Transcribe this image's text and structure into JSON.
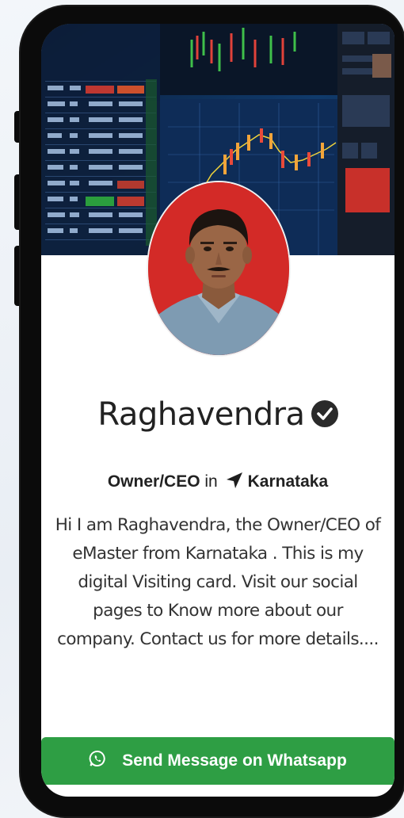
{
  "profile": {
    "name": "Raghavendra",
    "role": "Owner/CEO",
    "in_text": "in",
    "location": "Karnataka",
    "bio": "Hi I am Raghavendra, the Owner/CEO of eMaster from Karnataka . This is my digital Visiting card. Visit our social pages to Know more about our company. Contact us for more details...."
  },
  "actions": {
    "whatsapp_label": "Send Message on Whatsapp"
  },
  "icons": {
    "verified": "check-circle-icon",
    "location": "location-arrow-icon",
    "whatsapp": "whatsapp-icon"
  },
  "colors": {
    "whatsapp_button": "#2e9e44",
    "avatar_background": "#d32a27"
  }
}
